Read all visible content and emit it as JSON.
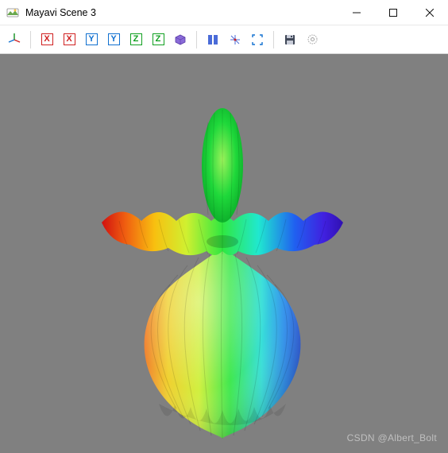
{
  "window": {
    "title": "Mayavi Scene 3"
  },
  "toolbar": {
    "axis_items": [
      {
        "name": "axis-x-plus",
        "label": "X",
        "cls": "axX"
      },
      {
        "name": "axis-x-minus",
        "label": "X",
        "cls": "axX"
      },
      {
        "name": "axis-y-plus",
        "label": "Y",
        "cls": "axY"
      },
      {
        "name": "axis-y-minus",
        "label": "Y",
        "cls": "axY"
      },
      {
        "name": "axis-z-plus",
        "label": "Z",
        "cls": "axZ"
      },
      {
        "name": "axis-z-minus",
        "label": "Z",
        "cls": "axZ"
      }
    ]
  },
  "watermark": "CSDN @Albert_Bolt",
  "colors": {
    "viewport_bg": "#808080",
    "accent": "#1070d0"
  }
}
